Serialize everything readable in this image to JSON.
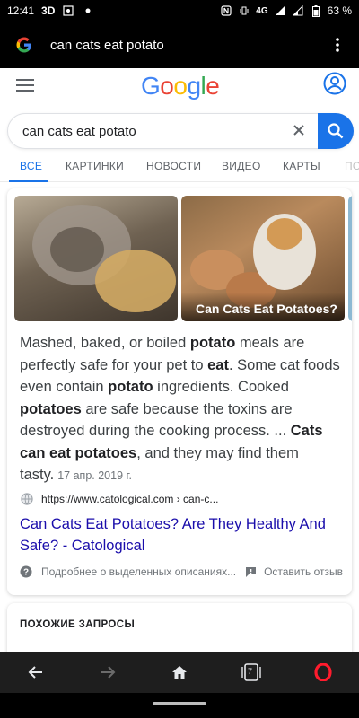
{
  "status_bar": {
    "time": "12:41",
    "network_3d": "3D",
    "signal_label": "4G",
    "battery": "63 %"
  },
  "browser": {
    "url_text": "can cats eat potato",
    "icons": [
      "google-icon",
      "more-vert-icon"
    ]
  },
  "header": {
    "logo_text": "Google",
    "logo_colors": [
      "#4285f4",
      "#ea4335",
      "#fbbc05",
      "#4285f4",
      "#34a853",
      "#ea4335"
    ]
  },
  "search": {
    "query": "can cats eat potato"
  },
  "tabs": [
    {
      "label": "ВСЕ",
      "active": true
    },
    {
      "label": "КАРТИНКИ"
    },
    {
      "label": "НОВОСТИ"
    },
    {
      "label": "ВИДЕО"
    },
    {
      "label": "КАРТЫ"
    },
    {
      "label": "ПО"
    }
  ],
  "featured": {
    "image_caption": "Can Cats Eat Potatoes?",
    "snippet": {
      "p1": "Mashed, baked, or boiled ",
      "b1": "potato",
      "p2": " meals are perfectly safe for your pet to ",
      "b2": "eat",
      "p3": ". Some cat foods even contain ",
      "b3": "potato",
      "p4": " ingredients. Cooked ",
      "b4": "potatoes",
      "p5": " are safe because the toxins are destroyed during the cooking process. ... ",
      "b5": "Cats can eat potatoes",
      "p6": ", and they may find them tasty.",
      "date": "17 апр. 2019 г."
    },
    "source_url": "https://www.catological.com › can-c...",
    "result_title": "Can Cats Eat Potatoes? Are They Healthy And Safe? - Catological",
    "footer_about": "Подробнее о выделенных описаниях...",
    "footer_feedback": "Оставить отзыв"
  },
  "related": {
    "title": "ПОХОЖИЕ ЗАПРОСЫ"
  },
  "bottom_nav": {
    "tab_count": "7"
  },
  "colors": {
    "accent_blue": "#1a73e8",
    "link": "#1a0dab",
    "opera_red": "#ff1b2d"
  }
}
